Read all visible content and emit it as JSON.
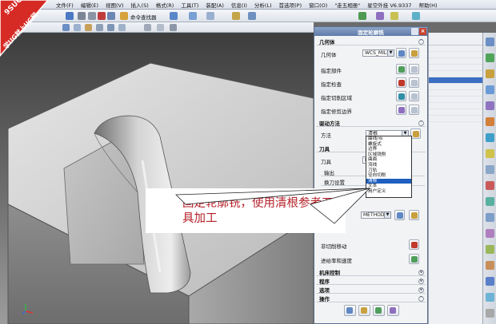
{
  "menubar": {
    "items": [
      "文件(F)",
      "编辑(E)",
      "视图(V)",
      "插入(S)",
      "格式(R)",
      "工具(T)",
      "装配(A)",
      "信息(I)",
      "分析(L)",
      "首选项(P)",
      "窗口(O)",
      "\"走五相册\"",
      "星空外挂 V6.9337",
      "帮助(H)"
    ]
  },
  "toolbar": {
    "command_finder_label": "命令查找器"
  },
  "logo": {
    "top_text": "9SUG",
    "bottom_text": "学UG就上UG网"
  },
  "dialog": {
    "title": "固定轮廓铣",
    "geometry_section": "几何体",
    "geometry_label": "几何体",
    "geometry_value": "WCS_MILL",
    "specify_part": "指定部件",
    "specify_check": "指定检查",
    "specify_cut_area": "指定切削区域",
    "specify_trim_boundary": "指定修剪边界",
    "drive_section": "驱动方法",
    "method_label": "方法",
    "method_value": "清根",
    "tool_section": "刀具",
    "tool_label": "刀具",
    "tool_value": "N",
    "output_label": "输出",
    "tool_change_label": "换刀设置",
    "method_combo_value": "METHOD",
    "non_cutting_moves": "非切削移动",
    "feeds_speeds": "进给率和速度",
    "machine_control": "机床控制",
    "program": "程序",
    "options": "选项",
    "actions": "操作"
  },
  "dropdown": {
    "items": [
      "曲线/点",
      "螺旋式",
      "边界",
      "区域铣削",
      "曲面",
      "流线",
      "刀轨",
      "径向切削",
      "清根",
      "文本",
      "用户定义"
    ],
    "selected_index": 8
  },
  "callout": {
    "text": "固定轮廓铣，使用清根参考刀具加工"
  },
  "colors": {
    "callout_text": "#b5212a",
    "selection": "#1e5fbf",
    "dialog_title": "#5e7aa8"
  }
}
